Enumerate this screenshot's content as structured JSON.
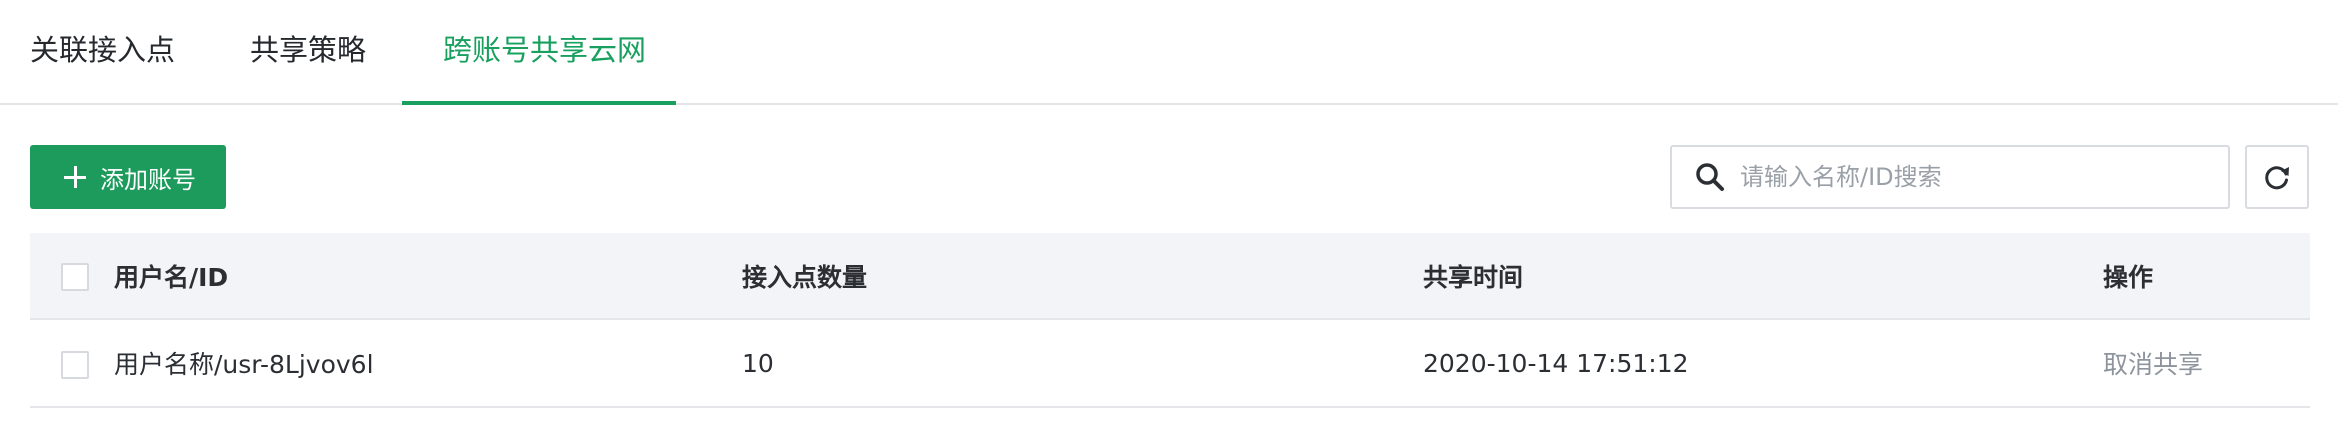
{
  "tabs": [
    {
      "label": "关联接入点",
      "active": false
    },
    {
      "label": "共享策略",
      "active": false
    },
    {
      "label": "跨账号共享云网",
      "active": true
    }
  ],
  "toolbar": {
    "add_button_label": "添加账号",
    "search_placeholder": "请输入名称/ID搜索",
    "search_icon": "search-icon",
    "refresh_icon": "refresh-icon"
  },
  "table": {
    "columns": [
      "用户名/ID",
      "接入点数量",
      "共享时间",
      "操作"
    ],
    "rows": [
      {
        "name_id": "用户名称/usr-8Ljvov6l",
        "count": "10",
        "time": "2020-10-14 17:51:12",
        "action": "取消共享"
      }
    ]
  },
  "colors": {
    "accent": "#19a05f",
    "button": "#1c9b5c",
    "header_bg": "#f2f4f7",
    "muted_link": "#8d949d"
  }
}
